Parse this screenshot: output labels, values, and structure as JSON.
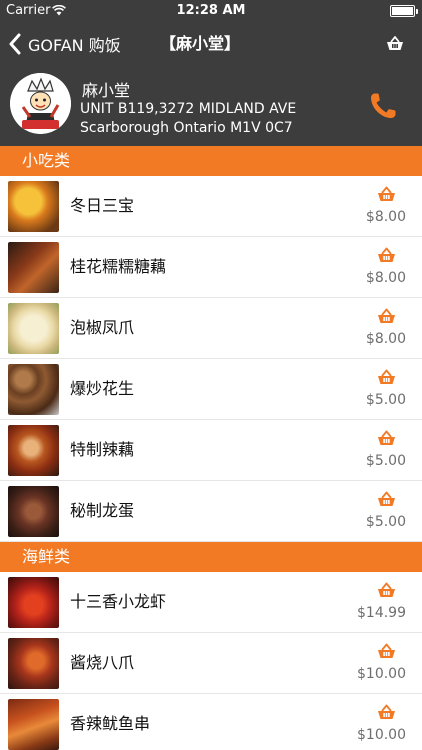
{
  "status_bar": {
    "carrier": "Carrier",
    "time": "12:28 AM"
  },
  "nav": {
    "back_label": "GOFAN 购饭",
    "title": "【麻小堂】",
    "cart_icon": "basket-icon"
  },
  "restaurant": {
    "name": "麻小堂",
    "address_line1": "UNIT B119,3272 MIDLAND AVE",
    "address_line2": "Scarborough Ontario M1V 0C7",
    "logo_text": "麻小堂",
    "phone_icon": "phone-icon"
  },
  "colors": {
    "accent": "#f27a24",
    "header_bg": "#3d3d3d",
    "price": "#6e6e6e"
  },
  "menu": {
    "categories": [
      {
        "name": "小吃类",
        "items": [
          {
            "name": "冬日三宝",
            "price": "$8.00"
          },
          {
            "name": "桂花糯糯糖藕",
            "price": "$8.00"
          },
          {
            "name": "泡椒凤爪",
            "price": "$8.00"
          },
          {
            "name": "爆炒花生",
            "price": "$5.00"
          },
          {
            "name": "特制辣藕",
            "price": "$5.00"
          },
          {
            "name": "秘制龙蛋",
            "price": "$5.00"
          }
        ]
      },
      {
        "name": "海鲜类",
        "items": [
          {
            "name": "十三香小龙虾",
            "price": "$14.99"
          },
          {
            "name": "酱烧八爪",
            "price": "$10.00"
          },
          {
            "name": "香辣鱿鱼串",
            "price": "$10.00"
          }
        ]
      }
    ]
  }
}
